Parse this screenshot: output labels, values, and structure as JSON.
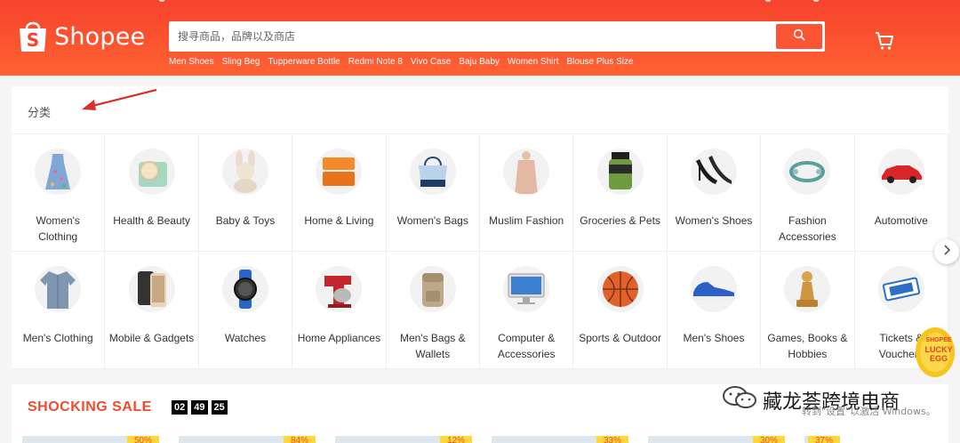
{
  "header": {
    "brand": "Shopee",
    "search_placeholder": "搜寻商品，品牌以及商店",
    "hot_words": [
      "Men Shoes",
      "Sling Beg",
      "Tupperware Bottle",
      "Redmi Note 8",
      "Vivo Case",
      "Baju Baby",
      "Women Shirt",
      "Blouse Plus Size"
    ],
    "icons": [
      "shopee-logo-icon",
      "search-icon",
      "cart-icon"
    ]
  },
  "categories": {
    "title": "分类",
    "items": [
      {
        "label": "Women's Clothing",
        "icon": "dress-icon"
      },
      {
        "label": "Health & Beauty",
        "icon": "compact-icon"
      },
      {
        "label": "Baby & Toys",
        "icon": "plush-bunny-icon"
      },
      {
        "label": "Home & Living",
        "icon": "container-icon"
      },
      {
        "label": "Women's Bags",
        "icon": "tote-bag-icon"
      },
      {
        "label": "Muslim Fashion",
        "icon": "robe-icon"
      },
      {
        "label": "Groceries & Pets",
        "icon": "jar-icon"
      },
      {
        "label": "Women's Shoes",
        "icon": "heels-icon"
      },
      {
        "label": "Fashion Accessories",
        "icon": "bracelet-icon"
      },
      {
        "label": "Automotive",
        "icon": "car-icon"
      },
      {
        "label": "Men's Clothing",
        "icon": "shirt-icon"
      },
      {
        "label": "Mobile & Gadgets",
        "icon": "phone-icon"
      },
      {
        "label": "Watches",
        "icon": "watch-icon"
      },
      {
        "label": "Home Appliances",
        "icon": "mixer-icon"
      },
      {
        "label": "Men's Bags & Wallets",
        "icon": "backpack-icon"
      },
      {
        "label": "Computer & Accessories",
        "icon": "monitor-icon"
      },
      {
        "label": "Sports & Outdoor",
        "icon": "basketball-icon"
      },
      {
        "label": "Men's Shoes",
        "icon": "sneaker-icon"
      },
      {
        "label": "Games, Books & Hobbies",
        "icon": "chess-pawn-icon"
      },
      {
        "label": "Tickets & Vouchers",
        "icon": "ticket-icon"
      }
    ]
  },
  "lucky_egg": {
    "line1": "SHOPEE",
    "line2": "LUCKY",
    "line3": "EGG"
  },
  "shocking_sale": {
    "title": "SHOCKING SALE",
    "timer": [
      "02",
      "49",
      "25"
    ],
    "badges": [
      "50%",
      "84%",
      "12%",
      "33%",
      "30%",
      "37%"
    ]
  },
  "watermark": {
    "brand": "藏龙荟跨境电商",
    "activate": "转到\"设置\"以激活 Windows。"
  },
  "colors": {
    "brand": "#ee4d2d",
    "header": "#f6432d",
    "badge": "#ffd839"
  }
}
